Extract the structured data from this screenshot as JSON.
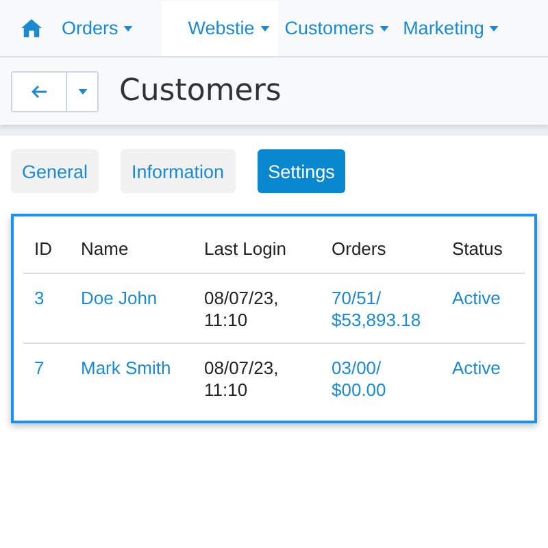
{
  "nav": {
    "items": [
      {
        "label": "Orders",
        "selected": false
      },
      {
        "label": "Webstie",
        "selected": true
      },
      {
        "label": "Customers",
        "selected": false
      },
      {
        "label": "Marketing",
        "selected": false
      }
    ]
  },
  "page": {
    "title": "Customers"
  },
  "tabs": [
    {
      "label": "General",
      "selected": false
    },
    {
      "label": "Information",
      "selected": false
    },
    {
      "label": "Settings",
      "selected": true
    }
  ],
  "table": {
    "columns": [
      "ID",
      "Name",
      "Last Login",
      "Orders",
      "Status"
    ],
    "rows": [
      {
        "id": "3",
        "name": "Doe John",
        "last_login": "08/07/23, 11:10",
        "orders": "70/51/ $53,893.18",
        "status": "Active"
      },
      {
        "id": "7",
        "name": "Mark Smith",
        "last_login": "08/07/23, 11:10",
        "orders": "03/00/ $00.00",
        "status": "Active"
      }
    ]
  }
}
